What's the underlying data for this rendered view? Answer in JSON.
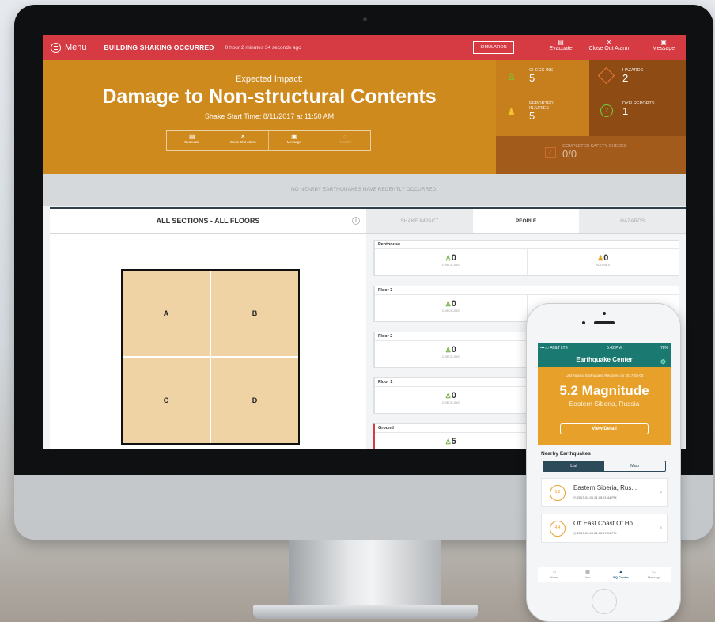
{
  "topbar": {
    "menu_label": "Menu",
    "alert_title": "BUILDING SHAKING OCCURRED",
    "elapsed": "0 hour 2 minutes 34 seconds ago",
    "simulation_label": "SIMULATION",
    "actions": [
      "Evacuate",
      "Close Out Alarm",
      "Message"
    ]
  },
  "impact": {
    "expected_label": "Expected Impact:",
    "headline": "Damage to Non-structural Contents",
    "shake_start": "Shake Start Time: 8/11/2017 at 11:50 AM",
    "actions": [
      "Evacuate",
      "Close Out Alarm",
      "Message",
      "Resolve"
    ]
  },
  "stats": {
    "checkins_label": "CHECK-INS",
    "checkins_value": "5",
    "hazards_label": "HAZARDS",
    "hazards_value": "2",
    "injuries_label": "REPORTED INJURIES",
    "injuries_value": "5",
    "dyfi_label": "DYFI REPORTS",
    "dyfi_value": "1",
    "safety_label": "COMPLETED SAFETY CHECKS",
    "safety_value": "0/0"
  },
  "notice": "NO NEARBY EARTHQUAKES HAVE RECENTLY OCCURRED.",
  "sections": {
    "title": "ALL SECTIONS - ALL FLOORS",
    "cells": [
      "A",
      "B",
      "C",
      "D"
    ]
  },
  "tabs": [
    "SHAKE IMPACT",
    "PEOPLE",
    "HAZARDS"
  ],
  "floors": [
    {
      "name": "Penthouse",
      "checkins": "0",
      "injuries": "0"
    },
    {
      "name": "Floor 3",
      "checkins": "0"
    },
    {
      "name": "Floor 2",
      "checkins": "0"
    },
    {
      "name": "Floor 1",
      "checkins": "0"
    },
    {
      "name": "Ground",
      "checkins": "5"
    }
  ],
  "floor_labels": {
    "checkins": "CHECK-INS",
    "injuries": "INJURIES"
  },
  "phone": {
    "carrier": "•••○○ AT&T LTE",
    "time": "5:42 PM",
    "battery": "78%",
    "title": "Earthquake Center",
    "last_label": "Last Nearby Earthquake Reported on 2017-03-05",
    "magnitude": "5.2 Magnitude",
    "location": "Eastern Siberia, Russia",
    "view_detail": "View Detail",
    "nearby_title": "Nearby Earthquakes",
    "seg_list": "List",
    "seg_map": "Map",
    "quakes": [
      {
        "mag": "5.2",
        "name": "Eastern Siberia, Rus...",
        "date": "2017-03-05 21:05:21:44 PM"
      },
      {
        "mag": "4.4",
        "name": "Off East Coast Of Ho...",
        "date": "2017-03-05 21:05:17:04 PM"
      }
    ],
    "nav": [
      "Home",
      "Info",
      "EQ Center",
      "Message"
    ]
  },
  "colors": {
    "alert_red": "#d63a43",
    "impact_orange": "#cf8a1d",
    "phone_teal": "#1a7a72",
    "phone_orange": "#e7a12b"
  }
}
